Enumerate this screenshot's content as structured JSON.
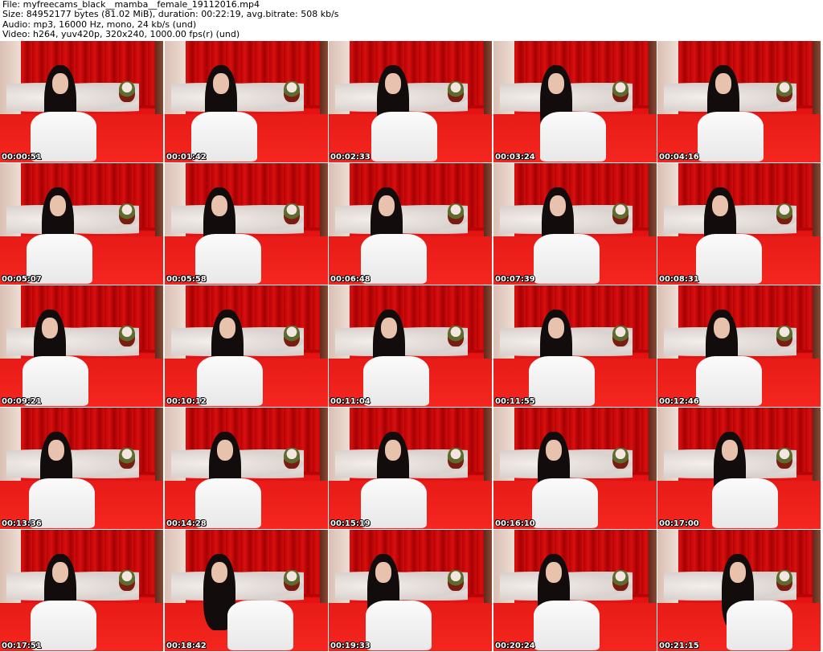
{
  "header": {
    "file_line": "File: myfreecams_black__mamba__female_19112016.mp4",
    "size_line": "Size: 84952177 bytes (81.02 MiB), duration: 00:22:19, avg.bitrate: 508 kb/s",
    "audio_line": "Audio: mp3, 16000 Hz, mono, 24 kb/s (und)",
    "video_line": "Video: h264, yuv420p, 320x240, 1000.00 fps(r) (und)"
  },
  "thumbnails": [
    {
      "timestamp": "00:00:51"
    },
    {
      "timestamp": "00:01:42"
    },
    {
      "timestamp": "00:02:33"
    },
    {
      "timestamp": "00:03:24"
    },
    {
      "timestamp": "00:04:16"
    },
    {
      "timestamp": "00:05:07"
    },
    {
      "timestamp": "00:05:58"
    },
    {
      "timestamp": "00:06:48"
    },
    {
      "timestamp": "00:07:39"
    },
    {
      "timestamp": "00:08:31"
    },
    {
      "timestamp": "00:09:21"
    },
    {
      "timestamp": "00:10:12"
    },
    {
      "timestamp": "00:11:04"
    },
    {
      "timestamp": "00:11:55"
    },
    {
      "timestamp": "00:12:46"
    },
    {
      "timestamp": "00:13:36"
    },
    {
      "timestamp": "00:14:28"
    },
    {
      "timestamp": "00:15:19"
    },
    {
      "timestamp": "00:16:10"
    },
    {
      "timestamp": "00:17:00"
    },
    {
      "timestamp": "00:17:51"
    },
    {
      "timestamp": "00:18:42"
    },
    {
      "timestamp": "00:19:33"
    },
    {
      "timestamp": "00:20:24"
    },
    {
      "timestamp": "00:21:15"
    }
  ],
  "colors": {
    "background": "#ffffff",
    "curtain_red": "#c9070a",
    "sheet_red": "#ef1a17",
    "timestamp_text": "#ffffff"
  }
}
